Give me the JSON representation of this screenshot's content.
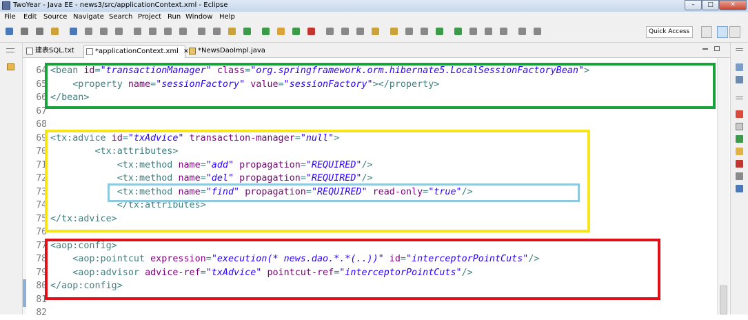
{
  "window": {
    "title": "TwoYear - Java EE - news3/src/applicationContext.xml - Eclipse",
    "controls": {
      "minimize": "–",
      "maximize": "□",
      "close": "✕"
    }
  },
  "menubar": [
    "File",
    "Edit",
    "Source",
    "Navigate",
    "Search",
    "Project",
    "Run",
    "Window",
    "Help"
  ],
  "toolbar": {
    "quick_access": "Quick Access"
  },
  "tabs": [
    {
      "label": "建表SQL.txt",
      "icon": "text-file-icon",
      "active": false
    },
    {
      "label": "*applicationContext.xml",
      "icon": "xml-file-icon",
      "active": true,
      "close": "✕"
    },
    {
      "label": "*NewsDaoImpl.java",
      "icon": "java-file-icon",
      "active": false
    }
  ],
  "editor": {
    "lines": [
      {
        "no": "64",
        "tokens": [
          [
            "tag",
            "<bean "
          ],
          [
            "attr",
            "id"
          ],
          [
            "tag",
            "="
          ],
          [
            "val",
            "\"transactionManager\""
          ],
          [
            "tag",
            " "
          ],
          [
            "attr",
            "class"
          ],
          [
            "tag",
            "="
          ],
          [
            "val",
            "\"org.springframework.orm.hibernate5.LocalSessionFactoryBean\""
          ],
          [
            "tag",
            ">"
          ]
        ]
      },
      {
        "no": "65",
        "tokens": [
          [
            "tag",
            "    <property "
          ],
          [
            "attr",
            "name"
          ],
          [
            "tag",
            "="
          ],
          [
            "val",
            "\"sessionFactory\""
          ],
          [
            "tag",
            " "
          ],
          [
            "attr",
            "value"
          ],
          [
            "tag",
            "="
          ],
          [
            "val",
            "\"sessionFactory\""
          ],
          [
            "tag",
            "></property>"
          ]
        ]
      },
      {
        "no": "66",
        "tokens": [
          [
            "tag",
            "</bean>"
          ]
        ]
      },
      {
        "no": "67",
        "tokens": []
      },
      {
        "no": "68",
        "tokens": []
      },
      {
        "no": "69",
        "tokens": [
          [
            "tag",
            "<tx:advice "
          ],
          [
            "attr",
            "id"
          ],
          [
            "tag",
            "="
          ],
          [
            "val",
            "\"txAdvice\""
          ],
          [
            "tag",
            " "
          ],
          [
            "attr",
            "transaction-manager"
          ],
          [
            "tag",
            "="
          ],
          [
            "val",
            "\"null\""
          ],
          [
            "tag",
            ">"
          ]
        ]
      },
      {
        "no": "70",
        "tokens": [
          [
            "tag",
            "        <tx:attributes>"
          ]
        ]
      },
      {
        "no": "71",
        "tokens": [
          [
            "tag",
            "            <tx:method "
          ],
          [
            "attr",
            "name"
          ],
          [
            "tag",
            "="
          ],
          [
            "val",
            "\"add\""
          ],
          [
            "tag",
            " "
          ],
          [
            "attr",
            "propagation"
          ],
          [
            "tag",
            "="
          ],
          [
            "val",
            "\"REQUIRED\""
          ],
          [
            "tag",
            "/>"
          ]
        ]
      },
      {
        "no": "72",
        "tokens": [
          [
            "tag",
            "            <tx:method "
          ],
          [
            "attr",
            "name"
          ],
          [
            "tag",
            "="
          ],
          [
            "val",
            "\"del\""
          ],
          [
            "tag",
            " "
          ],
          [
            "attr",
            "propagation"
          ],
          [
            "tag",
            "="
          ],
          [
            "val",
            "\"REQUIRED\""
          ],
          [
            "tag",
            "/>"
          ]
        ]
      },
      {
        "no": "73",
        "tokens": [
          [
            "tag",
            "            <tx:method "
          ],
          [
            "attr",
            "name"
          ],
          [
            "tag",
            "="
          ],
          [
            "val",
            "\"find\""
          ],
          [
            "tag",
            " "
          ],
          [
            "attr",
            "propagation"
          ],
          [
            "tag",
            "="
          ],
          [
            "val",
            "\"REQUIRED\""
          ],
          [
            "tag",
            " "
          ],
          [
            "attr",
            "read-only"
          ],
          [
            "tag",
            "="
          ],
          [
            "val",
            "\"true\""
          ],
          [
            "tag",
            "/>"
          ]
        ]
      },
      {
        "no": "74",
        "tokens": [
          [
            "tag",
            "            </tx:attributes>"
          ]
        ]
      },
      {
        "no": "75",
        "tokens": [
          [
            "tag",
            "</tx:advice>"
          ]
        ]
      },
      {
        "no": "76",
        "tokens": []
      },
      {
        "no": "77",
        "tokens": [
          [
            "tag",
            "<aop:config>"
          ]
        ]
      },
      {
        "no": "78",
        "tokens": [
          [
            "tag",
            "    <aop:pointcut "
          ],
          [
            "attr",
            "expression"
          ],
          [
            "tag",
            "="
          ],
          [
            "val",
            "\"execution(* news.dao.*.*(..))\""
          ],
          [
            "tag",
            " "
          ],
          [
            "attr",
            "id"
          ],
          [
            "tag",
            "="
          ],
          [
            "val",
            "\"interceptorPointCuts\""
          ],
          [
            "tag",
            "/>"
          ]
        ]
      },
      {
        "no": "79",
        "tokens": [
          [
            "tag",
            "    <aop:advisor "
          ],
          [
            "attr",
            "advice-ref"
          ],
          [
            "tag",
            "="
          ],
          [
            "val",
            "\"txAdvice\""
          ],
          [
            "tag",
            " "
          ],
          [
            "attr",
            "pointcut-ref"
          ],
          [
            "tag",
            "="
          ],
          [
            "val",
            "\"interceptorPointCuts\""
          ],
          [
            "tag",
            "/>"
          ]
        ]
      },
      {
        "no": "80",
        "tokens": [
          [
            "tag",
            "</aop:config>"
          ]
        ]
      },
      {
        "no": "81",
        "tokens": []
      },
      {
        "no": "82",
        "tokens": []
      }
    ]
  },
  "highlight_colors": {
    "green": "#1aa33a",
    "yellow": "#f5e51a",
    "light_blue": "#8ec9e0",
    "red": "#e0101a"
  }
}
